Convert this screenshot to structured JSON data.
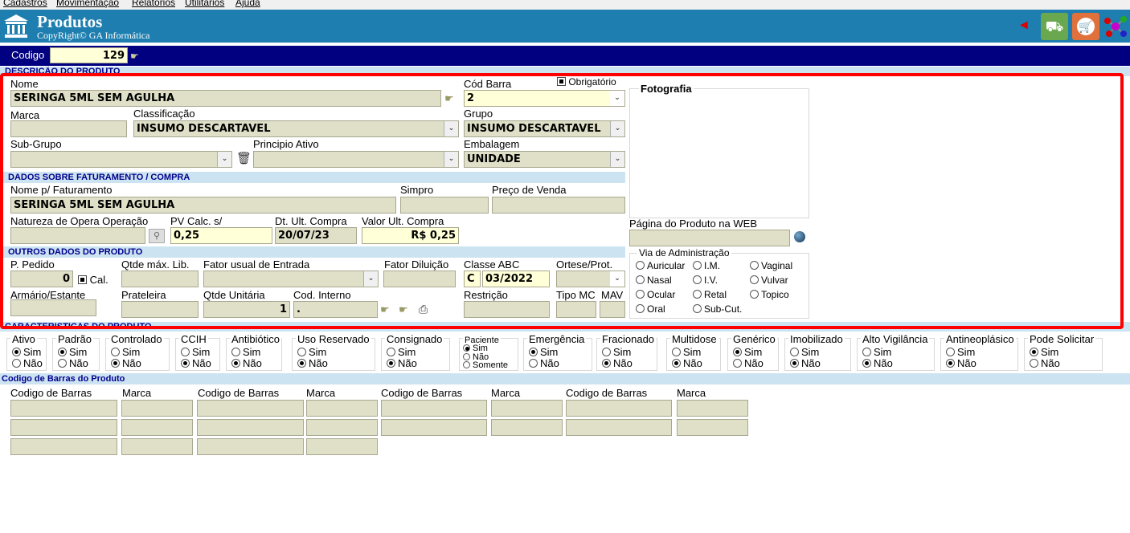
{
  "menu": [
    "Cadastros",
    "Movimentação",
    "Relatórios",
    "Utilitários",
    "Ajuda"
  ],
  "header": {
    "title": "Produtos",
    "subtitle": "CopyRight© GA Informática"
  },
  "codigo": {
    "label": "Codigo",
    "value": "129"
  },
  "sections": {
    "descricao": "DESCRIÇÃO DO PRODUTO",
    "faturamento": "DADOS SOBRE FATURAMENTO / COMPRA",
    "outros": "OUTROS DADOS DO PRODUTO",
    "caracteristicas": "CARACTERISTICAS DO PRODUTO",
    "barras": "Codigo de Barras do Produto"
  },
  "fields": {
    "nome": {
      "label": "Nome",
      "value": "SERINGA 5ML SEM AGULHA"
    },
    "cod_barra": {
      "label": "Cód Barra",
      "value": "2",
      "obrigatorio": "Obrigatório"
    },
    "marca": {
      "label": "Marca",
      "value": ""
    },
    "classificacao": {
      "label": "Classificação",
      "value": "INSUMO DESCARTAVEL"
    },
    "grupo": {
      "label": "Grupo",
      "value": "INSUMO DESCARTAVEL"
    },
    "sub_grupo": {
      "label": "Sub-Grupo",
      "value": ""
    },
    "principio": {
      "label": "Principio Ativo",
      "value": ""
    },
    "embalagem": {
      "label": "Embalagem",
      "value": "UNIDADE"
    },
    "nome_fat": {
      "label": "Nome p/ Faturamento",
      "value": "SERINGA 5ML SEM AGULHA"
    },
    "simpro": {
      "label": "Simpro",
      "value": ""
    },
    "preco_venda": {
      "label": "Preço de Venda",
      "value": ""
    },
    "natureza": {
      "label": "Natureza de Opera Operação",
      "value": ""
    },
    "pv_calc": {
      "label": "PV Calc. s/",
      "value": "0,25"
    },
    "dt_ult": {
      "label": "Dt. Ult. Compra",
      "value": "20/07/23"
    },
    "valor_ult": {
      "label": "Valor Ult. Compra",
      "value": "R$ 0,25"
    },
    "p_pedido": {
      "label": "P. Pedido",
      "value": "0",
      "cal": "Cal."
    },
    "qtde_max": {
      "label": "Qtde máx. Lib.",
      "value": ""
    },
    "fator_entrada": {
      "label": "Fator usual de Entrada",
      "value": ""
    },
    "fator_diluicao": {
      "label": "Fator Diluição",
      "value": ""
    },
    "classe_abc": {
      "label": "Classe ABC",
      "letter": "C",
      "date": "03/2022"
    },
    "ortese": {
      "label": "Ortese/Prot.",
      "value": ""
    },
    "armario": {
      "label": "Armário/Estante",
      "value": ""
    },
    "prateleira": {
      "label": "Prateleira",
      "value": ""
    },
    "qtde_unit": {
      "label": "Qtde Unitária",
      "value": "1"
    },
    "cod_interno": {
      "label": "Cod. Interno",
      "value": "."
    },
    "restricao": {
      "label": "Restrição",
      "value": ""
    },
    "tipo_mc": {
      "label": "Tipo MC",
      "value": ""
    },
    "mav": {
      "label": "MAV",
      "value": ""
    }
  },
  "foto": {
    "label": "Fotografia"
  },
  "web": {
    "label": "Página do Produto na WEB",
    "value": ""
  },
  "via": {
    "title": "Via de Administração",
    "options": [
      "Auricular",
      "I.M.",
      "Vaginal",
      "Nasal",
      "I.V.",
      "Vulvar",
      "Ocular",
      "Retal",
      "Topico",
      "Oral",
      "Sub-Cut."
    ]
  },
  "groups": [
    {
      "title": "Ativo",
      "opt1": "Sim",
      "opt2": "Não",
      "sel": 1
    },
    {
      "title": "Padrão",
      "opt1": "Sim",
      "opt2": "Não",
      "sel": 1
    },
    {
      "title": "Controlado",
      "opt1": "Sim",
      "opt2": "Não",
      "sel": 2
    },
    {
      "title": "CCIH",
      "opt1": "Sim",
      "opt2": "Não",
      "sel": 2
    },
    {
      "title": "Antibiótico",
      "opt1": "Sim",
      "opt2": "Não",
      "sel": 2
    },
    {
      "title": "Uso Reservado",
      "opt1": "Sim",
      "opt2": "Não",
      "sel": 2
    },
    {
      "title": "Consignado",
      "opt1": "Sim",
      "opt2": "Não",
      "sel": 2
    },
    {
      "title": "Emergência",
      "opt1": "Sim",
      "opt2": "Não",
      "sel": 1
    },
    {
      "title": "Fracionado",
      "opt1": "Sim",
      "opt2": "Não",
      "sel": 2
    },
    {
      "title": "Multidose",
      "opt1": "Sim",
      "opt2": "Não",
      "sel": 2
    },
    {
      "title": "Genérico",
      "opt1": "Sim",
      "opt2": "Não",
      "sel": 1
    },
    {
      "title": "Imobilizado",
      "opt1": "Sim",
      "opt2": "Não",
      "sel": 2
    },
    {
      "title": "Alto Vigilância",
      "opt1": "Sim",
      "opt2": "Não",
      "sel": 2
    },
    {
      "title": "Antineoplásico",
      "opt1": "Sim",
      "opt2": "Não",
      "sel": 2
    },
    {
      "title": "Pode Solicitar",
      "opt1": "Sim",
      "opt2": "Não",
      "sel": 1
    }
  ],
  "paciente": {
    "title": "Paciente",
    "opts": [
      "Sim",
      "Não",
      "Somente"
    ],
    "sel": 0
  },
  "barcodes": {
    "col_codigo": "Codigo de Barras",
    "col_marca": "Marca"
  }
}
